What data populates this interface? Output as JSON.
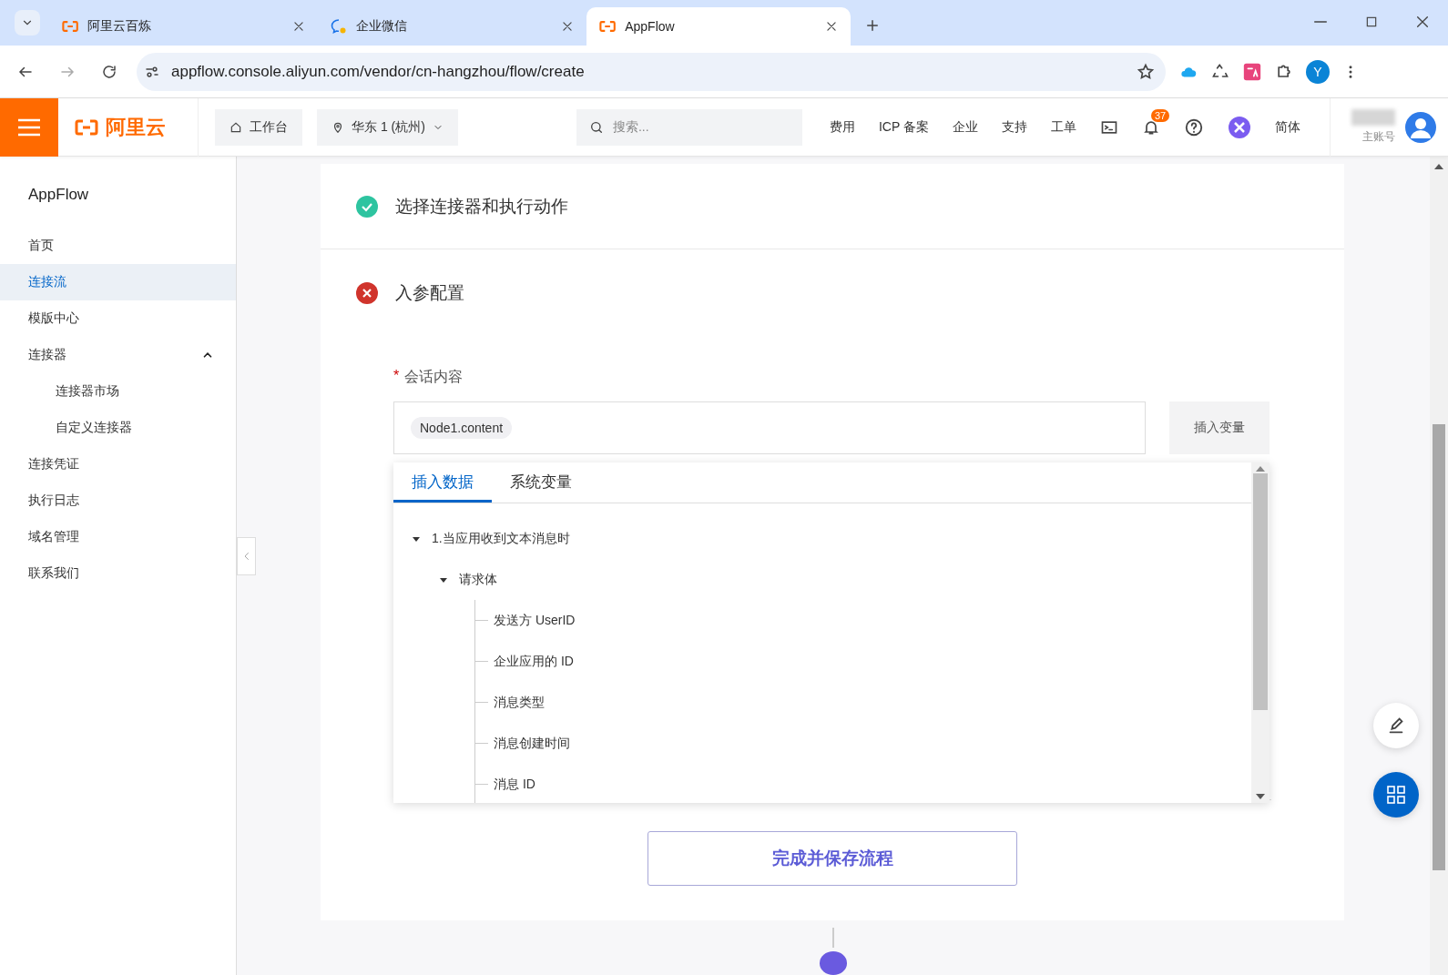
{
  "browser": {
    "tabs": [
      {
        "title": "阿里云百炼",
        "kind": "aliyun",
        "selected": false
      },
      {
        "title": "企业微信",
        "kind": "wecom",
        "selected": false
      },
      {
        "title": "AppFlow",
        "kind": "aliyun",
        "selected": true
      }
    ],
    "url": "appflow.console.aliyun.com/vendor/cn-hangzhou/flow/create",
    "profile_initial": "Y"
  },
  "header": {
    "logo": "阿里云",
    "workbench": "工作台",
    "region": "华东 1 (杭州)",
    "search_placeholder": "搜索...",
    "nav": [
      "费用",
      "ICP 备案",
      "企业",
      "支持",
      "工单"
    ],
    "notification_count": "37",
    "language": "简体",
    "account_label": "主账号"
  },
  "sidebar": {
    "title": "AppFlow",
    "items": [
      {
        "label": "首页",
        "selected": false
      },
      {
        "label": "连接流",
        "selected": true
      },
      {
        "label": "模版中心",
        "selected": false
      },
      {
        "label": "连接器",
        "selected": false,
        "expanded": true,
        "children": [
          {
            "label": "连接器市场",
            "selected": false
          },
          {
            "label": "自定义连接器",
            "selected": false
          }
        ]
      },
      {
        "label": "连接凭证",
        "selected": false
      },
      {
        "label": "执行日志",
        "selected": false
      },
      {
        "label": "域名管理",
        "selected": false
      },
      {
        "label": "联系我们",
        "selected": false
      }
    ]
  },
  "steps": [
    {
      "title": "选择连接器和执行动作",
      "completed": true
    },
    {
      "title": "入参配置",
      "completed": false
    }
  ],
  "field": {
    "required_mark": "*",
    "label": "会话内容",
    "token": "Node1.content",
    "button": "插入变量"
  },
  "dropdown": {
    "tabs": [
      {
        "label": "插入数据",
        "selected": true
      },
      {
        "label": "系统变量",
        "selected": false
      }
    ],
    "tree": [
      {
        "label": "1.当应用收到文本消息时",
        "expanded": true,
        "children": [
          {
            "label": "请求体",
            "expanded": true,
            "children": [
              {
                "label": "发送方 UserID"
              },
              {
                "label": "企业应用的 ID"
              },
              {
                "label": "消息类型"
              },
              {
                "label": "消息创建时间"
              },
              {
                "label": "消息 ID"
              }
            ]
          }
        ]
      }
    ]
  },
  "save_button": "完成并保存流程"
}
